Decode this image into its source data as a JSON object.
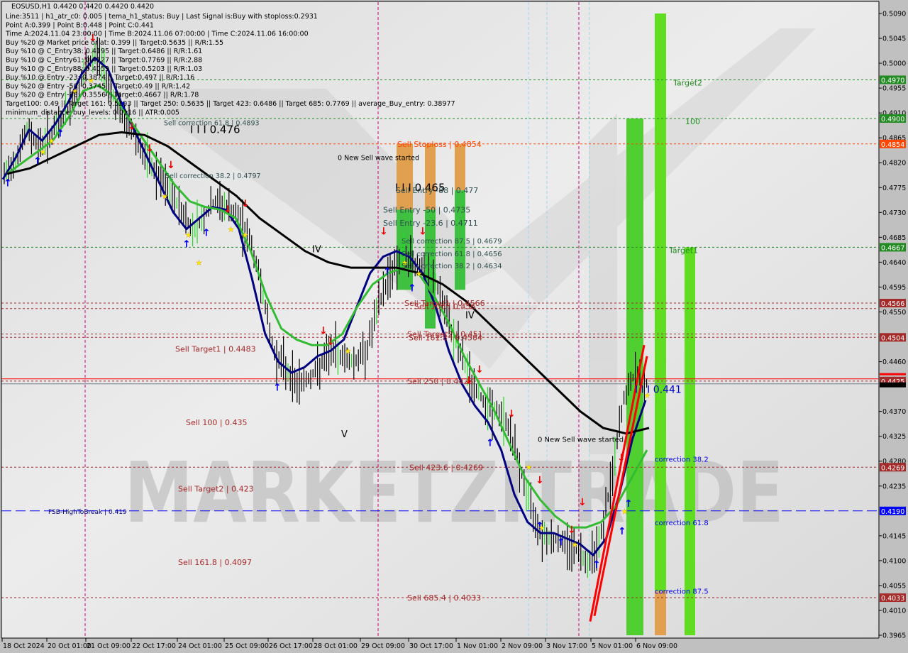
{
  "window": {
    "title": "EOSUSD,H1  0.4420 0.4420 0.4420 0.4420"
  },
  "info_panel": [
    "Line:3511 | h1_atr_c0: 0.005 | tema_h1_status: Buy | Last Signal is:Buy with stoploss:0.2931",
    "Point A:0.399 | Point B:0.448 | Point C:0.441",
    "Time A:2024.11.04 23:00:00 | Time B:2024.11.06 07:00:00 | Time C:2024.11.06 16:00:00",
    "Buy %20 @ Market price or at: 0.399 || Target:0.5635 || R/R:1.55",
    "Buy %10 @ C_Entry38: 0.4195 || Target:0.6486 || R/R:1.61",
    "Buy %10 @ C_Entry61: 0.4127 || Target:0.7769 || R/R:2.88",
    "Buy %10 @ C_Entry88: 0.4059 || Target:0.5203 || R/R:1.03",
    "Buy %10 @ Entry -23: 0.3874 || Target:0.497 || R/R:1.16",
    "Buy %20 @ Entry -50: 0.3745 || Target:0.49 || R/R:1.42",
    "Buy %20 @ Entry -88: 0.3556 || Target:0.4667 || R/R:1.78",
    "Target100: 0.49 || Target 161: 0.5203 || Target 250: 0.5635 || Target 423: 0.6486 || Target 685: 0.7769 || average_Buy_entry: 0.38977",
    "minimum_distance_buy_levels: 0.0116 || ATR:0.005"
  ],
  "watermark": "MARKETZITRADE",
  "chart_data": {
    "type": "line",
    "title": "EOSUSD,H1",
    "symbol": "EOSUSD",
    "timeframe": "H1",
    "ohlc_current": {
      "open": 0.442,
      "high": 0.442,
      "low": 0.442,
      "close": 0.442
    },
    "ylim": [
      0.3965,
      0.509
    ],
    "y_ticks": [
      "0.5090",
      "0.5045",
      "0.5000",
      "0.4955",
      "0.4910",
      "0.4865",
      "0.4820",
      "0.4775",
      "0.4730",
      "0.4685",
      "0.4640",
      "0.4595",
      "0.4550",
      "0.4460",
      "0.4370",
      "0.4325",
      "0.4280",
      "0.4235",
      "0.4145",
      "0.4100",
      "0.4055",
      "0.4010",
      "0.3965"
    ],
    "x_ticks": [
      "18 Oct 2024",
      "20 Oct 01:00",
      "21 Oct 09:00",
      "22 Oct 17:00",
      "24 Oct 01:00",
      "25 Oct 09:00",
      "26 Oct 17:00",
      "28 Oct 01:00",
      "29 Oct 09:00",
      "30 Oct 17:00",
      "1 Nov 01:00",
      "2 Nov 09:00",
      "3 Nov 17:00",
      "5 Nov 01:00",
      "6 Nov 09:00"
    ],
    "price_badges": [
      {
        "value": "0.4970",
        "color": "#228b22"
      },
      {
        "value": "0.4900",
        "color": "#228b22"
      },
      {
        "value": "0.4854",
        "color": "#ff4500"
      },
      {
        "value": "0.4667",
        "color": "#228b22"
      },
      {
        "value": "0.4566",
        "color": "#a52a2a"
      },
      {
        "value": "0.4504",
        "color": "#a52a2a"
      },
      {
        "value": "0.4425",
        "color": "#a52a2a"
      },
      {
        "value": "0.4269",
        "color": "#a52a2a"
      },
      {
        "value": "0.4190",
        "color": "#0000ff"
      },
      {
        "value": "0.4033",
        "color": "#a52a2a"
      }
    ],
    "horizontal_levels": [
      {
        "price": 0.497,
        "color": "#228b22",
        "style": "dashed"
      },
      {
        "price": 0.49,
        "color": "#228b22",
        "style": "dashed"
      },
      {
        "price": 0.4854,
        "color": "#ff4500",
        "style": "dashed"
      },
      {
        "price": 0.4667,
        "color": "#228b22",
        "style": "dashed"
      },
      {
        "price": 0.4566,
        "color": "#a52a2a",
        "style": "dashed"
      },
      {
        "price": 0.4556,
        "color": "#a52a2a",
        "style": "dashed"
      },
      {
        "price": 0.451,
        "color": "#a52a2a",
        "style": "dashed"
      },
      {
        "price": 0.4504,
        "color": "#a52a2a",
        "style": "dashed"
      },
      {
        "price": 0.4429,
        "color": "#ff0000",
        "style": "solid"
      },
      {
        "price": 0.4425,
        "color": "#a52a2a",
        "style": "dashed"
      },
      {
        "price": 0.442,
        "color": "#708090",
        "style": "solid"
      },
      {
        "price": 0.4269,
        "color": "#a52a2a",
        "style": "dashed"
      },
      {
        "price": 0.419,
        "color": "#0000ff",
        "style": "longdash"
      },
      {
        "price": 0.4033,
        "color": "#a52a2a",
        "style": "dashed"
      }
    ],
    "annotations": [
      {
        "text": "Sell correction 61.8 | 0.4893",
        "price": 0.4893,
        "color": "#2f4f4f"
      },
      {
        "text": "I I I 0.476",
        "price": 0.488,
        "color": "#000000"
      },
      {
        "text": "Sell Stoploss | 0.4854",
        "price": 0.4854,
        "color": "#ff4500"
      },
      {
        "text": "0 New Sell wave started",
        "price": 0.483,
        "color": "#000000"
      },
      {
        "text": "Sell correction 38.2 | 0.4797",
        "price": 0.4797,
        "color": "#2f4f4f"
      },
      {
        "text": "I I I 0.465",
        "price": 0.4775,
        "color": "#000000"
      },
      {
        "text": "Sell Entry -88 | 0.477",
        "price": 0.477,
        "color": "#2f4f4f"
      },
      {
        "text": "Sell Entry -50 | 0.4735",
        "price": 0.4735,
        "color": "#2f4f4f"
      },
      {
        "text": "Sell Entry -23.6 | 0.4711",
        "price": 0.4711,
        "color": "#2f4f4f"
      },
      {
        "text": "Sell correction 87.5 | 0.4679",
        "price": 0.4679,
        "color": "#2f4f4f"
      },
      {
        "text": "Sell correction 61.8 | 0.4656",
        "price": 0.4656,
        "color": "#2f4f4f"
      },
      {
        "text": "Sell correction 38.2 | 0.4634",
        "price": 0.4634,
        "color": "#2f4f4f"
      },
      {
        "text": "IV",
        "price": 0.4664,
        "color": "#000000"
      },
      {
        "text": "Sell Target1 | 0.4566",
        "price": 0.4566,
        "color": "#a52a2a"
      },
      {
        "text": "Sell 100 | 0.456",
        "price": 0.456,
        "color": "#a52a2a"
      },
      {
        "text": "IV",
        "price": 0.4545,
        "color": "#000000"
      },
      {
        "text": "Sell Target2 | 0.451",
        "price": 0.451,
        "color": "#a52a2a"
      },
      {
        "text": "Sell 161.8 | 0.4504",
        "price": 0.4504,
        "color": "#a52a2a"
      },
      {
        "text": "Sell Target1 | 0.4483",
        "price": 0.4483,
        "color": "#a52a2a"
      },
      {
        "text": "Sell 250 | 0.4425",
        "price": 0.4425,
        "color": "#a52a2a"
      },
      {
        "text": "I I I 0.441",
        "price": 0.441,
        "color": "#0000cd"
      },
      {
        "text": "Sell 100 | 0.435",
        "price": 0.435,
        "color": "#a52a2a"
      },
      {
        "text": "V",
        "price": 0.433,
        "color": "#000000"
      },
      {
        "text": "0 New Sell wave started",
        "price": 0.432,
        "color": "#000000"
      },
      {
        "text": "Sell 423.6 | 0.4269",
        "price": 0.4269,
        "color": "#a52a2a"
      },
      {
        "text": "Sell Target2 | 0.423",
        "price": 0.423,
        "color": "#a52a2a"
      },
      {
        "text": "FSB-HighToBreak | 0.419",
        "price": 0.419,
        "color": "#000080"
      },
      {
        "text": "Sell 161.8 | 0.4097",
        "price": 0.4097,
        "color": "#a52a2a"
      },
      {
        "text": "Sell 685.4 | 0.4033",
        "price": 0.4033,
        "color": "#a52a2a"
      },
      {
        "text": "Target2",
        "price": 0.4965,
        "color": "#228b22"
      },
      {
        "text": "100",
        "price": 0.4895,
        "color": "#228b22"
      },
      {
        "text": "Target1",
        "price": 0.4662,
        "color": "#228b22"
      },
      {
        "text": "correction 38.2",
        "price": 0.4284,
        "color": "#0000ff"
      },
      {
        "text": "correction 61.8",
        "price": 0.4169,
        "color": "#0000ff"
      },
      {
        "text": "correction 87.5",
        "price": 0.4045,
        "color": "#0000ff"
      }
    ],
    "zone_bars": [
      {
        "from": 0.4854,
        "to": 0.4735,
        "color": "#e0a050",
        "label": "sell-stoploss-zone-1"
      },
      {
        "from": 0.4735,
        "to": 0.459,
        "color": "#40c040",
        "label": "sell-entry-zone-1"
      },
      {
        "from": 0.4854,
        "to": 0.4735,
        "color": "#e0a050",
        "label": "sell-stoploss-zone-2"
      },
      {
        "from": 0.4735,
        "to": 0.452,
        "color": "#40c040",
        "label": "sell-entry-zone-2"
      },
      {
        "from": 0.4854,
        "to": 0.477,
        "color": "#e0a050",
        "label": "sell-stoploss-zone-3"
      },
      {
        "from": 0.477,
        "to": 0.459,
        "color": "#40c040",
        "label": "sell-entry-zone-3"
      },
      {
        "from": 0.49,
        "to": 0.3965,
        "color": "#50d030",
        "label": "buy-zone-1"
      },
      {
        "from": 0.509,
        "to": 0.4045,
        "color": "#60dd20",
        "label": "buy-zone-2"
      },
      {
        "from": 0.4045,
        "to": 0.3965,
        "color": "#e0a050",
        "label": "buy-stop-zone"
      },
      {
        "from": 0.4667,
        "to": 0.3965,
        "color": "#60dd20",
        "label": "buy-zone-3"
      }
    ],
    "series": [
      {
        "name": "close",
        "color": "#000000",
        "values": [
          0.4795,
          0.483,
          0.488,
          0.485,
          0.487,
          0.49,
          0.4935,
          0.499,
          0.502,
          0.496,
          0.4905,
          0.488,
          0.483,
          0.48,
          0.477,
          0.474,
          0.47,
          0.472,
          0.475,
          0.474,
          0.472,
          0.468,
          0.46,
          0.448,
          0.445,
          0.442,
          0.443,
          0.445,
          0.448,
          0.447,
          0.446,
          0.448,
          0.456,
          0.462,
          0.465,
          0.464,
          0.463,
          0.46,
          0.453,
          0.448,
          0.442,
          0.439,
          0.437,
          0.435,
          0.428,
          0.42,
          0.415,
          0.414,
          0.413,
          0.412,
          0.41,
          0.414,
          0.425,
          0.439,
          0.444,
          0.442
        ]
      },
      {
        "name": "tema-fast",
        "color": "#000080",
        "values": [
          0.479,
          0.483,
          0.488,
          0.486,
          0.489,
          0.493,
          0.498,
          0.501,
          0.499,
          0.493,
          0.488,
          0.483,
          0.478,
          0.473,
          0.47,
          0.472,
          0.474,
          0.4735,
          0.47,
          0.461,
          0.451,
          0.446,
          0.444,
          0.445,
          0.447,
          0.448,
          0.45,
          0.456,
          0.462,
          0.465,
          0.466,
          0.465,
          0.462,
          0.456,
          0.448,
          0.442,
          0.438,
          0.435,
          0.43,
          0.422,
          0.417,
          0.415,
          0.415,
          0.414,
          0.413,
          0.411,
          0.414,
          0.422,
          0.432,
          0.439
        ]
      },
      {
        "name": "ma-mid",
        "color": "#33bb33",
        "values": [
          0.48,
          0.482,
          0.484,
          0.486,
          0.49,
          0.495,
          0.496,
          0.494,
          0.49,
          0.486,
          0.482,
          0.478,
          0.475,
          0.474,
          0.4735,
          0.472,
          0.466,
          0.458,
          0.452,
          0.45,
          0.449,
          0.449,
          0.451,
          0.456,
          0.46,
          0.462,
          0.463,
          0.462,
          0.458,
          0.453,
          0.447,
          0.442,
          0.437,
          0.431,
          0.425,
          0.421,
          0.418,
          0.416,
          0.416,
          0.417,
          0.42,
          0.425,
          0.43
        ]
      },
      {
        "name": "ma-slow",
        "color": "#000000",
        "values": [
          0.48,
          0.481,
          0.483,
          0.485,
          0.487,
          0.4875,
          0.487,
          0.485,
          0.482,
          0.479,
          0.476,
          0.472,
          0.469,
          0.466,
          0.464,
          0.463,
          0.463,
          0.463,
          0.462,
          0.46,
          0.457,
          0.453,
          0.449,
          0.445,
          0.441,
          0.437,
          0.434,
          0.433,
          0.434
        ]
      }
    ]
  }
}
